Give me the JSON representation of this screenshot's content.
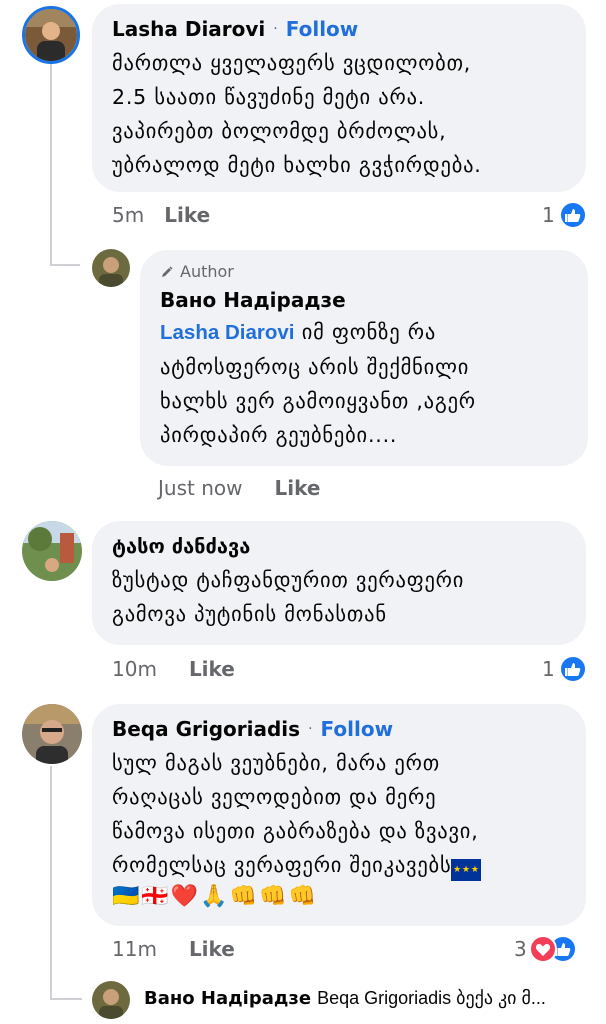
{
  "comments": [
    {
      "author": "Lasha Diarovi",
      "dot": "·",
      "follow": "Follow",
      "text": "მართლა ყველაფერს ვცდილობთ,\n2.5 საათი წავუძინე მეტი არა.\nვაპირებთ ბოლომდე ბრძოლას,\nუბრალოდ მეტი ხალხი გვჭირდება.",
      "time": "5m",
      "like": "Like",
      "reaction_count": "1"
    },
    {
      "author_badge": "Author",
      "author": "Вано Надірадзе",
      "mention": "Lasha Diarovi",
      "text": " იმ ფონზე რა\nატმოსფეროც არის შექმნილი\nხალხს ვერ გამოიყვანთ ,აგერ\nპირდაპირ გეუბნები....",
      "time": "Just now",
      "like": "Like"
    },
    {
      "author": "ტასო ძანძავა",
      "text": "ზუსტად ტაჩფანდურით ვერაფერი\nგამოვა პუტინის მონასთან",
      "time": "10m",
      "like": "Like",
      "reaction_count": "1"
    },
    {
      "author": "Beqa Grigoriadis",
      "dot": "·",
      "follow": "Follow",
      "text": "სულ მაგას ვეუბნები, მარა ერთ\nრაღაცას ველოდებით და მერე\nწამოვა ისეთი გაბრაზება და ზვავი,\nრომელსაც ვერაფერი შეიკავებს",
      "emojis": [
        "🇺🇦",
        "🇬🇪",
        "❤️",
        "🙏",
        "👊",
        "👊",
        "👊"
      ],
      "time": "11m",
      "like": "Like",
      "reaction_count": "3"
    }
  ],
  "reply_preview": {
    "author": "Вано Надірадзе",
    "text": "Beqa Grigoriadis ბექა კი მ..."
  },
  "colors": {
    "bubble": "#f0f2f5",
    "link": "#216fdb",
    "meta": "#65676b",
    "like_blue": "#1877f2",
    "love_red": "#f33e58"
  },
  "icons": [
    "pencil-icon",
    "thumbs-up-icon",
    "heart-icon",
    "eu-flag-icon"
  ]
}
